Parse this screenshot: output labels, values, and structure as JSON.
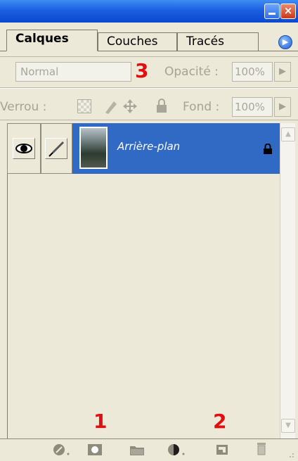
{
  "window": {
    "close_glyph": "×"
  },
  "tabs": [
    {
      "label": "Calques",
      "active": true
    },
    {
      "label": "Couches",
      "active": false
    },
    {
      "label": "Tracés",
      "active": false
    }
  ],
  "blend": {
    "mode": "Normal",
    "opacity_label": "Opacité :",
    "opacity_value": "100%"
  },
  "lock": {
    "label": "Verrou :",
    "fill_label": "Fond :",
    "fill_value": "100%"
  },
  "layers": [
    {
      "name": "Arrière-plan",
      "visible": true,
      "locked": true
    }
  ],
  "annotations": {
    "marker_1": "1",
    "marker_2": "2",
    "marker_3": "3",
    "color": "#e01010"
  },
  "colors": {
    "titlebar": "#1c5fe0",
    "selection": "#316ac5",
    "panel": "#ece9d8"
  },
  "footer_icons": [
    "link-layers-icon",
    "add-mask-icon",
    "new-group-icon",
    "adjustment-layer-icon",
    "new-layer-icon",
    "trash-icon"
  ]
}
